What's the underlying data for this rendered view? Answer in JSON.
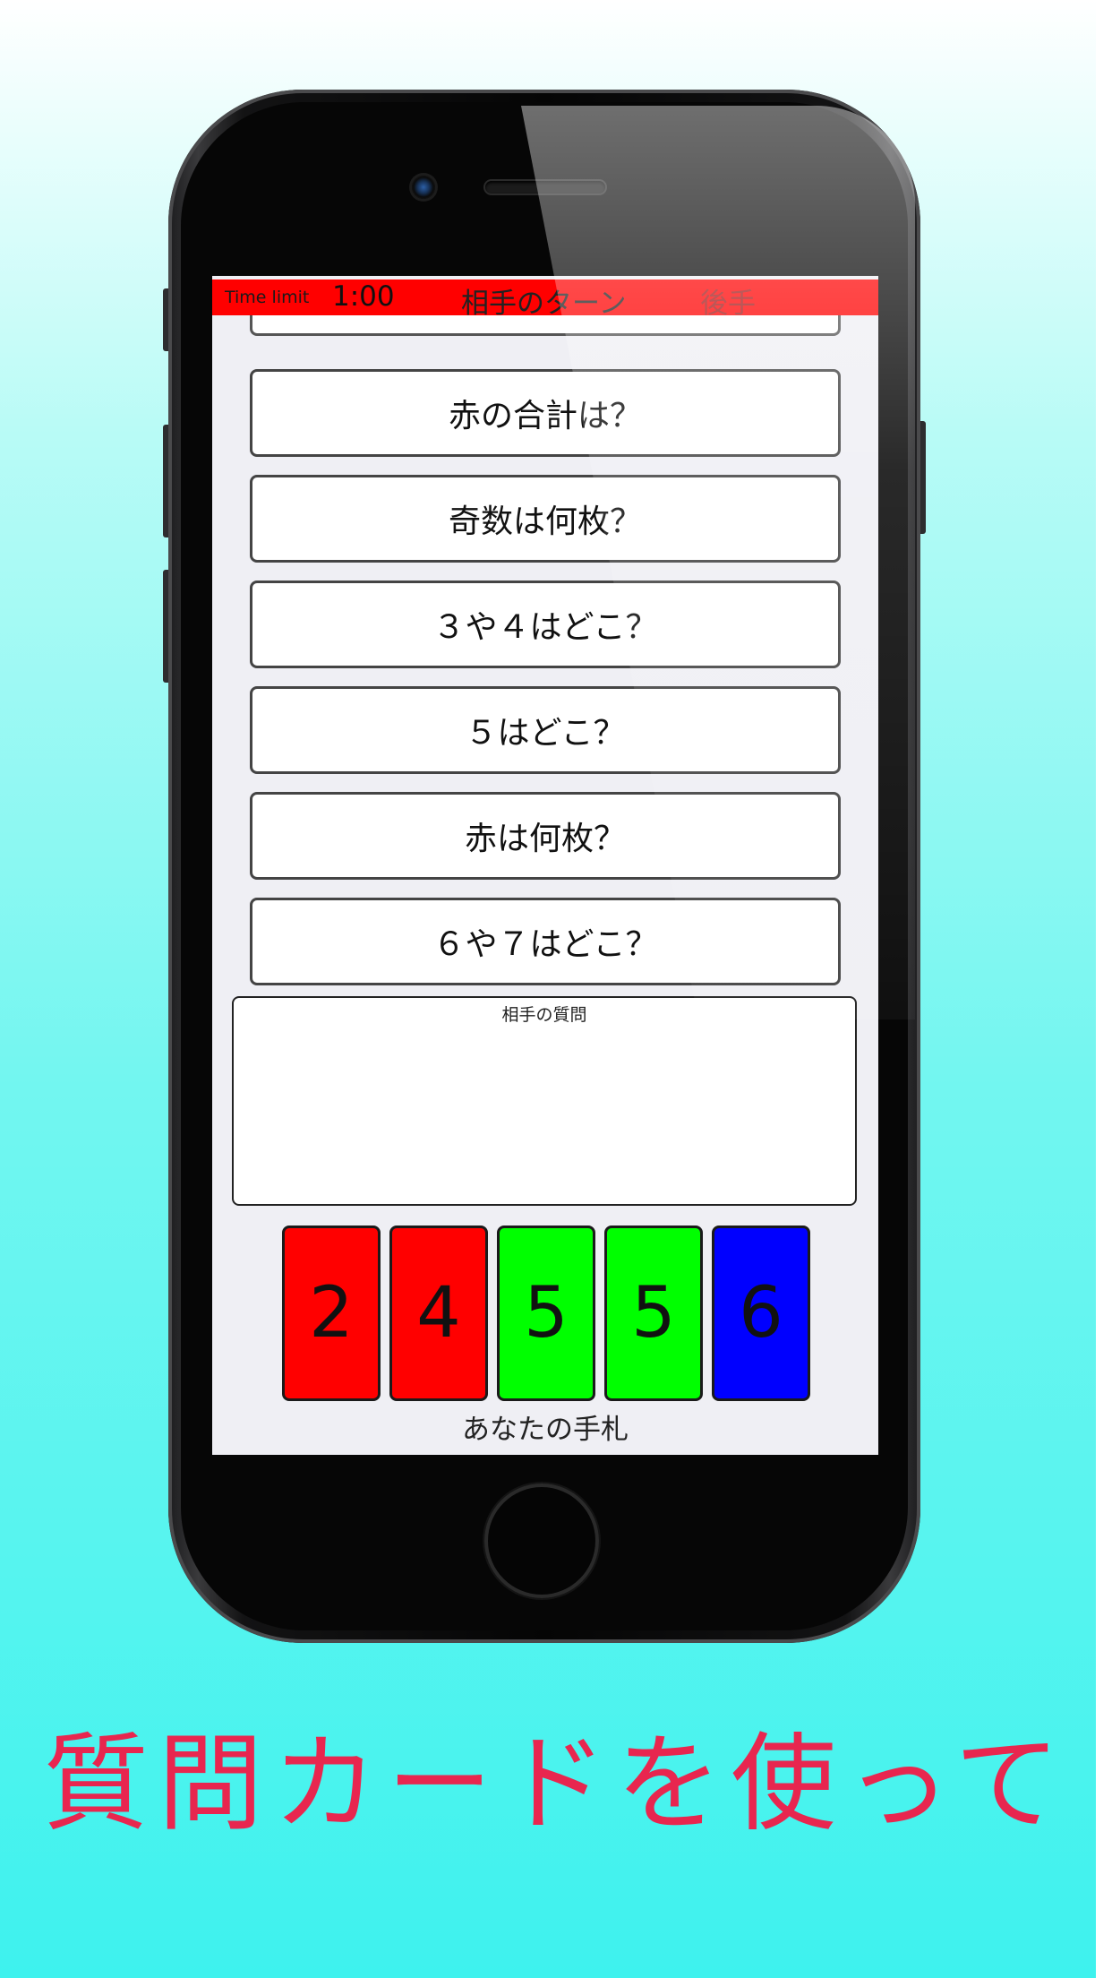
{
  "status_bar": {
    "time_limit_label": "Time limit",
    "time_value": "1:00",
    "turn_label": "相手のターン",
    "order_label": "後手",
    "bar_color": "#ff0000"
  },
  "question_cards": [
    {
      "label": "赤の合計は？"
    },
    {
      "label": "奇数は何枚？"
    },
    {
      "label": "３や４はどこ？"
    },
    {
      "label": "５はどこ？"
    },
    {
      "label": "赤は何枚？"
    },
    {
      "label": "６や７はどこ？"
    }
  ],
  "opponent_question": {
    "title": "相手の質問"
  },
  "hand": {
    "label": "あなたの手札",
    "cards": [
      {
        "value": "2",
        "color": "#ff0000"
      },
      {
        "value": "4",
        "color": "#ff0000"
      },
      {
        "value": "5",
        "color": "#00ff00"
      },
      {
        "value": "5",
        "color": "#00ff00"
      },
      {
        "value": "6",
        "color": "#0000ff"
      }
    ]
  },
  "caption": {
    "text": "質問カードを使って",
    "color": "#e8264f"
  }
}
